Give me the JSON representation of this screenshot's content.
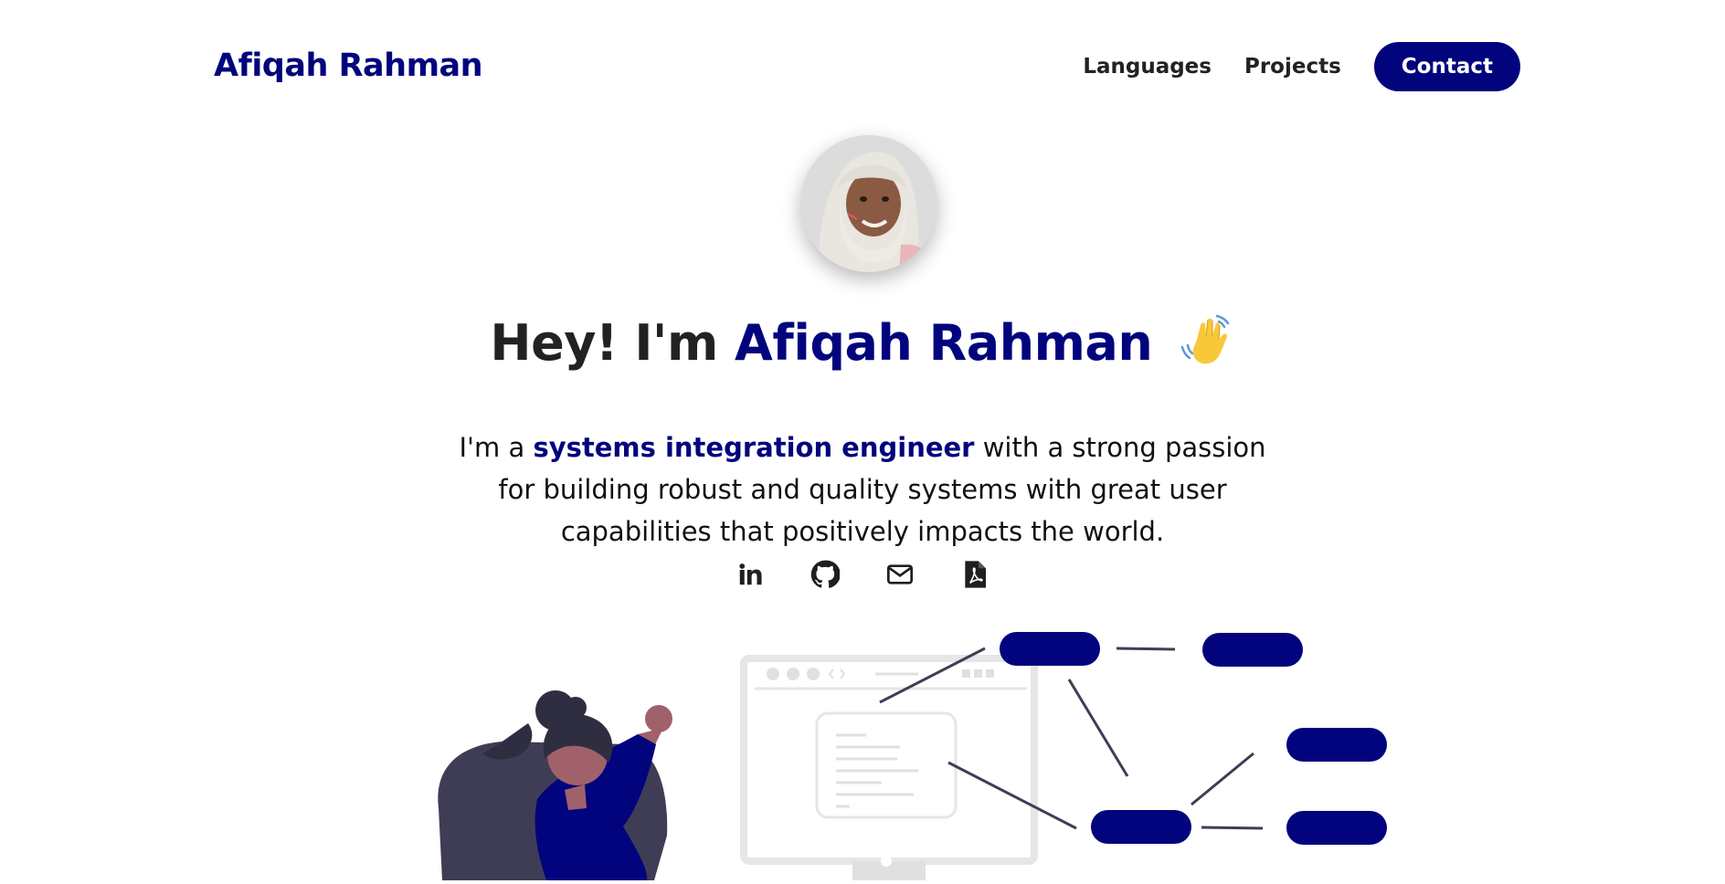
{
  "brand": {
    "name": "Afiqah Rahman"
  },
  "nav": {
    "items": [
      {
        "label": "Languages"
      },
      {
        "label": "Projects"
      }
    ],
    "contact_label": "Contact"
  },
  "hero": {
    "greeting": "Hey! I'm ",
    "name": "Afiqah Rahman",
    "wave_icon": "waving-hand-icon",
    "intro_prefix": "I'm a ",
    "intro_role": "systems integration engineer",
    "intro_suffix": " with a strong passion for building robust and quality systems with great user capabilities that positively impacts the world."
  },
  "socials": [
    {
      "icon": "linkedin-icon"
    },
    {
      "icon": "github-icon"
    },
    {
      "icon": "email-icon"
    },
    {
      "icon": "pdf-resume-icon"
    }
  ],
  "colors": {
    "accent": "#02047d",
    "text": "#222222",
    "illustration_dark": "#3f3d56",
    "skin": "#a0616a"
  }
}
